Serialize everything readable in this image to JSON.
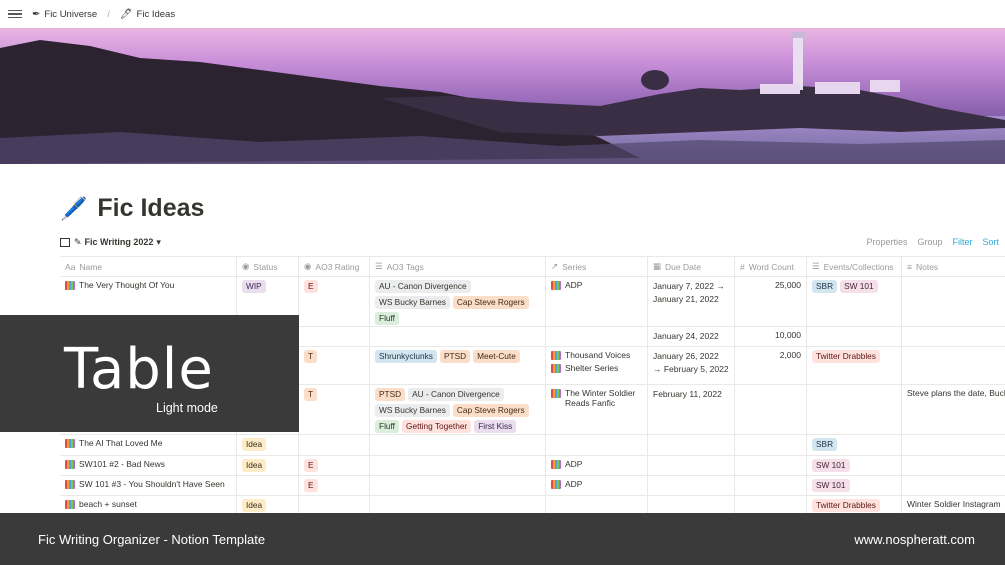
{
  "breadcrumb": {
    "workspace": "Fic Universe",
    "page": "Fic Ideas"
  },
  "page": {
    "title": "Fic Ideas",
    "emoji": "🖊️"
  },
  "view": {
    "name": "Fic Writing 2022",
    "actions": [
      "Properties",
      "Group",
      "Filter",
      "Sort"
    ]
  },
  "columns": [
    "Name",
    "Status",
    "AO3 Rating",
    "AO3 Tags",
    "Series",
    "Due Date",
    "Word Count",
    "Events/Collections",
    "Notes"
  ],
  "rows": [
    {
      "name": "The Very Thought Of You",
      "status": {
        "label": "WIP",
        "color": "purple"
      },
      "rating": "E",
      "tags": [
        [
          "AU - Canon Divergence",
          "gray"
        ],
        [
          "WS Bucky Barnes",
          "gray"
        ],
        [
          "Cap Steve Rogers",
          "orange"
        ],
        [
          "Fluff",
          "green"
        ]
      ],
      "series": [
        "ADP"
      ],
      "due": "January 7, 2022 → January 21, 2022",
      "words": "25,000",
      "events": [
        [
          "SBR",
          "blue"
        ],
        [
          "SW 101",
          "pink"
        ]
      ],
      "notes": ""
    },
    {
      "name": "",
      "status": null,
      "rating": "",
      "tags": [],
      "series": [],
      "due": "January 24, 2022",
      "words": "10,000",
      "events": [],
      "notes": ""
    },
    {
      "name": "",
      "status": null,
      "rating": "T",
      "tags": [
        [
          "Shrunkyclunks",
          "blue"
        ],
        [
          "PTSD",
          "orange"
        ],
        [
          "Meet-Cute",
          "orange"
        ]
      ],
      "series": [
        "Thousand Voices",
        "Shelter Series"
      ],
      "due": "January 26, 2022 → February 5, 2022",
      "words": "2,000",
      "events": [
        [
          "Twitter Drabbles",
          "red"
        ]
      ],
      "notes": ""
    },
    {
      "name": "",
      "status": null,
      "rating": "T",
      "tags": [
        [
          "PTSD",
          "orange"
        ],
        [
          "AU - Canon Divergence",
          "gray"
        ],
        [
          "WS Bucky Barnes",
          "gray"
        ],
        [
          "Cap Steve Rogers",
          "orange"
        ],
        [
          "Fluff",
          "green"
        ],
        [
          "Getting Together",
          "red"
        ],
        [
          "First Kiss",
          "purple"
        ]
      ],
      "series": [
        "The Winter Soldier Reads Fanfic"
      ],
      "due": "February 11, 2022",
      "words": "",
      "events": [],
      "notes": "Steve plans the date, Bucky"
    },
    {
      "name": "The AI That Loved Me",
      "status": {
        "label": "Idea",
        "color": "yellow"
      },
      "rating": "",
      "tags": [],
      "series": [],
      "due": "",
      "words": "",
      "events": [
        [
          "SBR",
          "blue"
        ]
      ],
      "notes": ""
    },
    {
      "name": "SW101 #2 - Bad News",
      "status": {
        "label": "Idea",
        "color": "yellow"
      },
      "rating": "E",
      "tags": [],
      "series": [
        "ADP"
      ],
      "due": "",
      "words": "",
      "events": [
        [
          "SW 101",
          "pink"
        ]
      ],
      "notes": ""
    },
    {
      "name": "SW 101 #3 - You Shouldn't Have Seen",
      "status": null,
      "rating": "E",
      "tags": [],
      "series": [
        "ADP"
      ],
      "due": "",
      "words": "",
      "events": [
        [
          "SW 101",
          "pink"
        ]
      ],
      "notes": ""
    },
    {
      "name": "beach + sunset",
      "status": {
        "label": "Idea",
        "color": "yellow"
      },
      "rating": "",
      "tags": [],
      "series": [],
      "due": "",
      "words": "",
      "events": [
        [
          "Twitter Drabbles",
          "red"
        ]
      ],
      "notes": "Winter Soldier Instagram"
    }
  ],
  "overlay": {
    "title": "Table",
    "subtitle": "Light mode"
  },
  "footer": {
    "left": "Fic Writing Organizer - Notion Template",
    "right": "www.nospheratt.com"
  }
}
